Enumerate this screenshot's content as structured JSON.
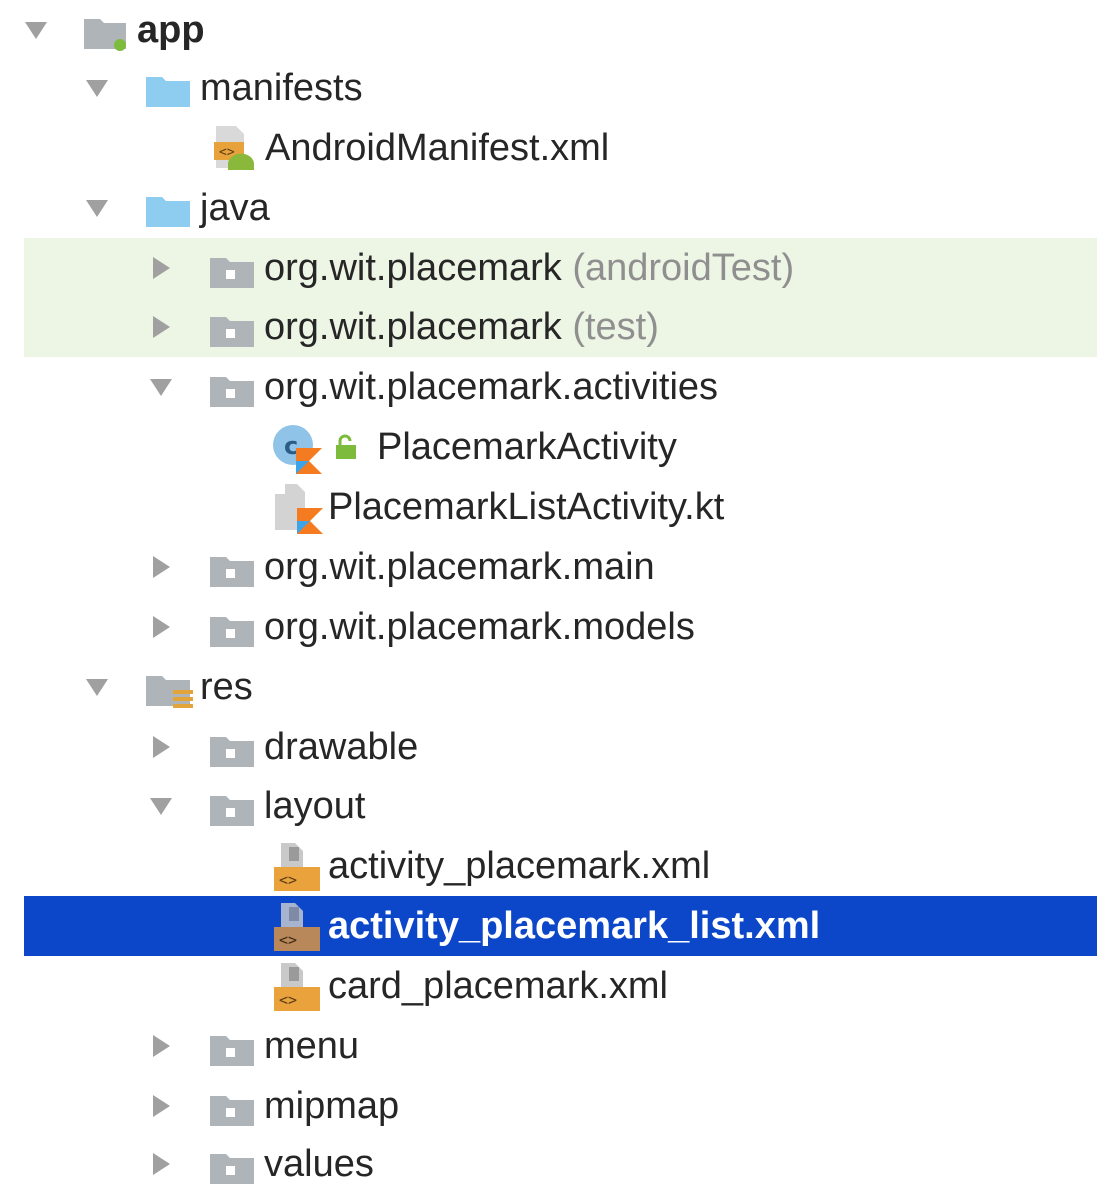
{
  "project_tree": {
    "root": {
      "label": "app",
      "expanded": true
    },
    "manifests": {
      "label": "manifests",
      "expanded": true
    },
    "android_manifest": {
      "label": "AndroidManifest.xml"
    },
    "java": {
      "label": "java",
      "expanded": true
    },
    "pkg_android_test": {
      "label": "org.wit.placemark",
      "suffix": "(androidTest)",
      "expanded": false
    },
    "pkg_test": {
      "label": "org.wit.placemark",
      "suffix": "(test)",
      "expanded": false
    },
    "pkg_activities": {
      "label": "org.wit.placemark.activities",
      "expanded": true
    },
    "placemark_activity": {
      "label": "PlacemarkActivity"
    },
    "placemark_list_activity": {
      "label": "PlacemarkListActivity.kt"
    },
    "pkg_main": {
      "label": "org.wit.placemark.main",
      "expanded": false
    },
    "pkg_models": {
      "label": "org.wit.placemark.models",
      "expanded": false
    },
    "res": {
      "label": "res",
      "expanded": true
    },
    "drawable": {
      "label": "drawable",
      "expanded": false
    },
    "layout": {
      "label": "layout",
      "expanded": true
    },
    "activity_placemark_xml": {
      "label": "activity_placemark.xml"
    },
    "activity_placemark_list_xml": {
      "label": "activity_placemark_list.xml",
      "selected": true
    },
    "card_placemark_xml": {
      "label": "card_placemark.xml"
    },
    "menu": {
      "label": "menu",
      "expanded": false
    },
    "mipmap": {
      "label": "mipmap",
      "expanded": false
    },
    "values": {
      "label": "values",
      "expanded": false
    }
  },
  "colors": {
    "selection": "#0d47c9",
    "test_highlight": "#edf5e5",
    "source_folder": "#8ecdf0",
    "package_folder": "#aeb4b8",
    "kotlin_orange": "#f57b20",
    "kotlin_blue": "#3fa3e8"
  },
  "icons": {
    "expanded_arrow": "triangle-down",
    "collapsed_arrow": "triangle-right",
    "module": "module-folder-icon",
    "source_root": "source-folder-icon",
    "package": "package-folder-icon",
    "resources": "resources-folder-icon",
    "manifest_file": "android-manifest-icon",
    "kotlin_class": "kotlin-class-icon",
    "kotlin_file": "kotlin-file-icon",
    "xml_layout": "xml-layout-icon"
  }
}
